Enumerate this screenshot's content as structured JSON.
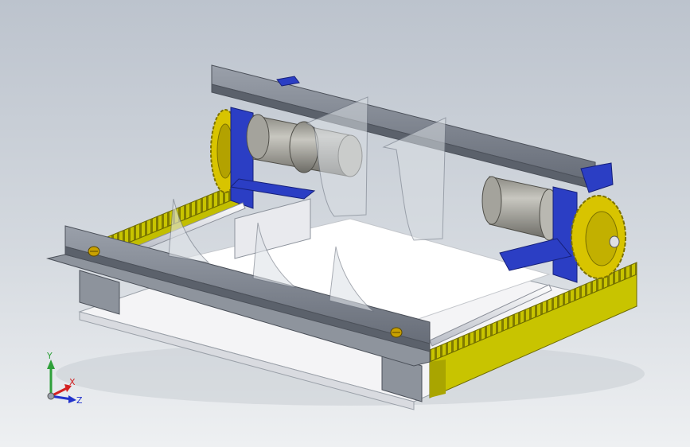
{
  "viewport": {
    "background_top": "#bcc3cd",
    "background_bottom": "#eef0f2"
  },
  "triad": {
    "x_label": "X",
    "y_label": "Y",
    "z_label": "Z",
    "x_color": "#d42020",
    "y_color": "#2fa03a",
    "z_color": "#2233cc"
  },
  "model": {
    "rack_color": "#c8c400",
    "frame_color": "#7c8390",
    "bracket_color": "#2b3ec4",
    "motor_color": "#9b9a92",
    "panel_color": "#ffffff",
    "rod_color": "#e8e8ee",
    "gear_color": "#d8c400",
    "screw_color": "#c9a100"
  }
}
